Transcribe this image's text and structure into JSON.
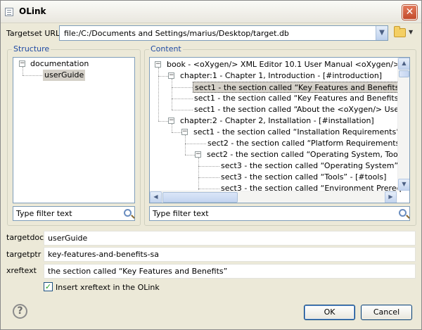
{
  "window": {
    "title": "OLink"
  },
  "targetset": {
    "label": "Targetset URL",
    "value": "file:/C:/Documents and Settings/marius/Desktop/target.db"
  },
  "structure": {
    "title": "Structure",
    "tree": [
      {
        "label": "documentation",
        "expanded": true
      },
      {
        "label": "userGuide",
        "selected": true
      }
    ],
    "filter_placeholder": "Type filter text"
  },
  "content": {
    "title": "Content",
    "tree": [
      {
        "label": "book - <oXygen/> XML Editor 10.1 User Manual <oXygen/> XML",
        "toggle": "⊟"
      },
      {
        "label": "chapter:1 - Chapter 1, Introduction - [#introduction]",
        "toggle": "⊟"
      },
      {
        "label": "sect1 - the section called “Key Features and Benefits” - [#ke",
        "selected": true
      },
      {
        "label": "sect1 - the section called “Key Features and Benefits” - [#ke"
      },
      {
        "label": "sect1 - the section called “About the <oXygen/> User Manua"
      },
      {
        "label": "chapter:2 - Chapter 2, Installation - [#installation]",
        "toggle": "⊟"
      },
      {
        "label": "sect1 - the section called “Installation Requirements” - [#inst",
        "toggle": "⊟"
      },
      {
        "label": "sect2 - the section called “Platform Requirements” - [#pla"
      },
      {
        "label": "sect2 - the section called “Operating System, Tools and E",
        "toggle": "⊟"
      },
      {
        "label": "sect3 - the section called “Operating System” - [#op"
      },
      {
        "label": "sect3 - the section called “Tools” - [#tools]"
      },
      {
        "label": "sect3 - the section called “Environment Prerequisites"
      }
    ],
    "filter_placeholder": "Type filter text"
  },
  "targetdoc": {
    "label": "targetdoc",
    "value": "userGuide"
  },
  "targetptr": {
    "label": "targetptr",
    "value": "key-features-and-benefits-sa"
  },
  "xreftext": {
    "label": "xreftext",
    "value": "the section called “Key Features and Benefits”"
  },
  "insert_xref": {
    "label": "Insert xreftext in the OLink",
    "checked": true
  },
  "buttons": {
    "ok": "OK",
    "cancel": "Cancel"
  },
  "icons": {
    "help": "?",
    "close": "✕",
    "combo_arrow": "▼",
    "collapse": "−"
  }
}
